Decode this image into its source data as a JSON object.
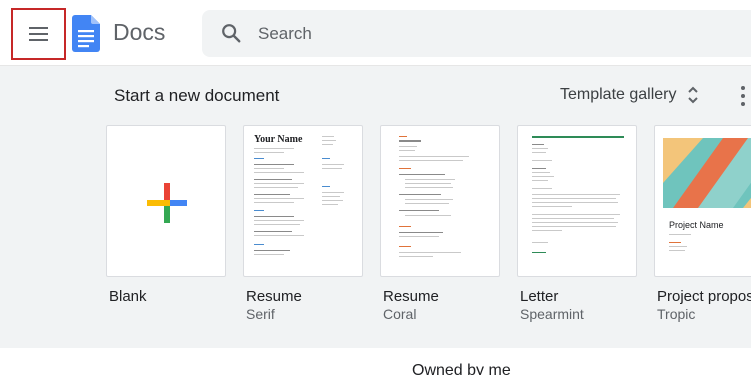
{
  "header": {
    "app_title": "Docs",
    "search_placeholder": "Search"
  },
  "templates_section": {
    "title": "Start a new document",
    "gallery_label": "Template gallery",
    "items": [
      {
        "name": "Blank",
        "sub": ""
      },
      {
        "name": "Resume",
        "sub": "Serif"
      },
      {
        "name": "Resume",
        "sub": "Coral"
      },
      {
        "name": "Letter",
        "sub": "Spearmint"
      },
      {
        "name": "Project proposal",
        "sub": "Tropic"
      }
    ],
    "resume_serif_heading": "Your Name",
    "project_heading": "Project Name"
  },
  "bottom": {
    "owned_by_label": "Owned by me"
  },
  "colors": {
    "menu_highlight": "#c62828",
    "docs_blue": "#4285f4",
    "band_background": "#f1f3f4"
  }
}
